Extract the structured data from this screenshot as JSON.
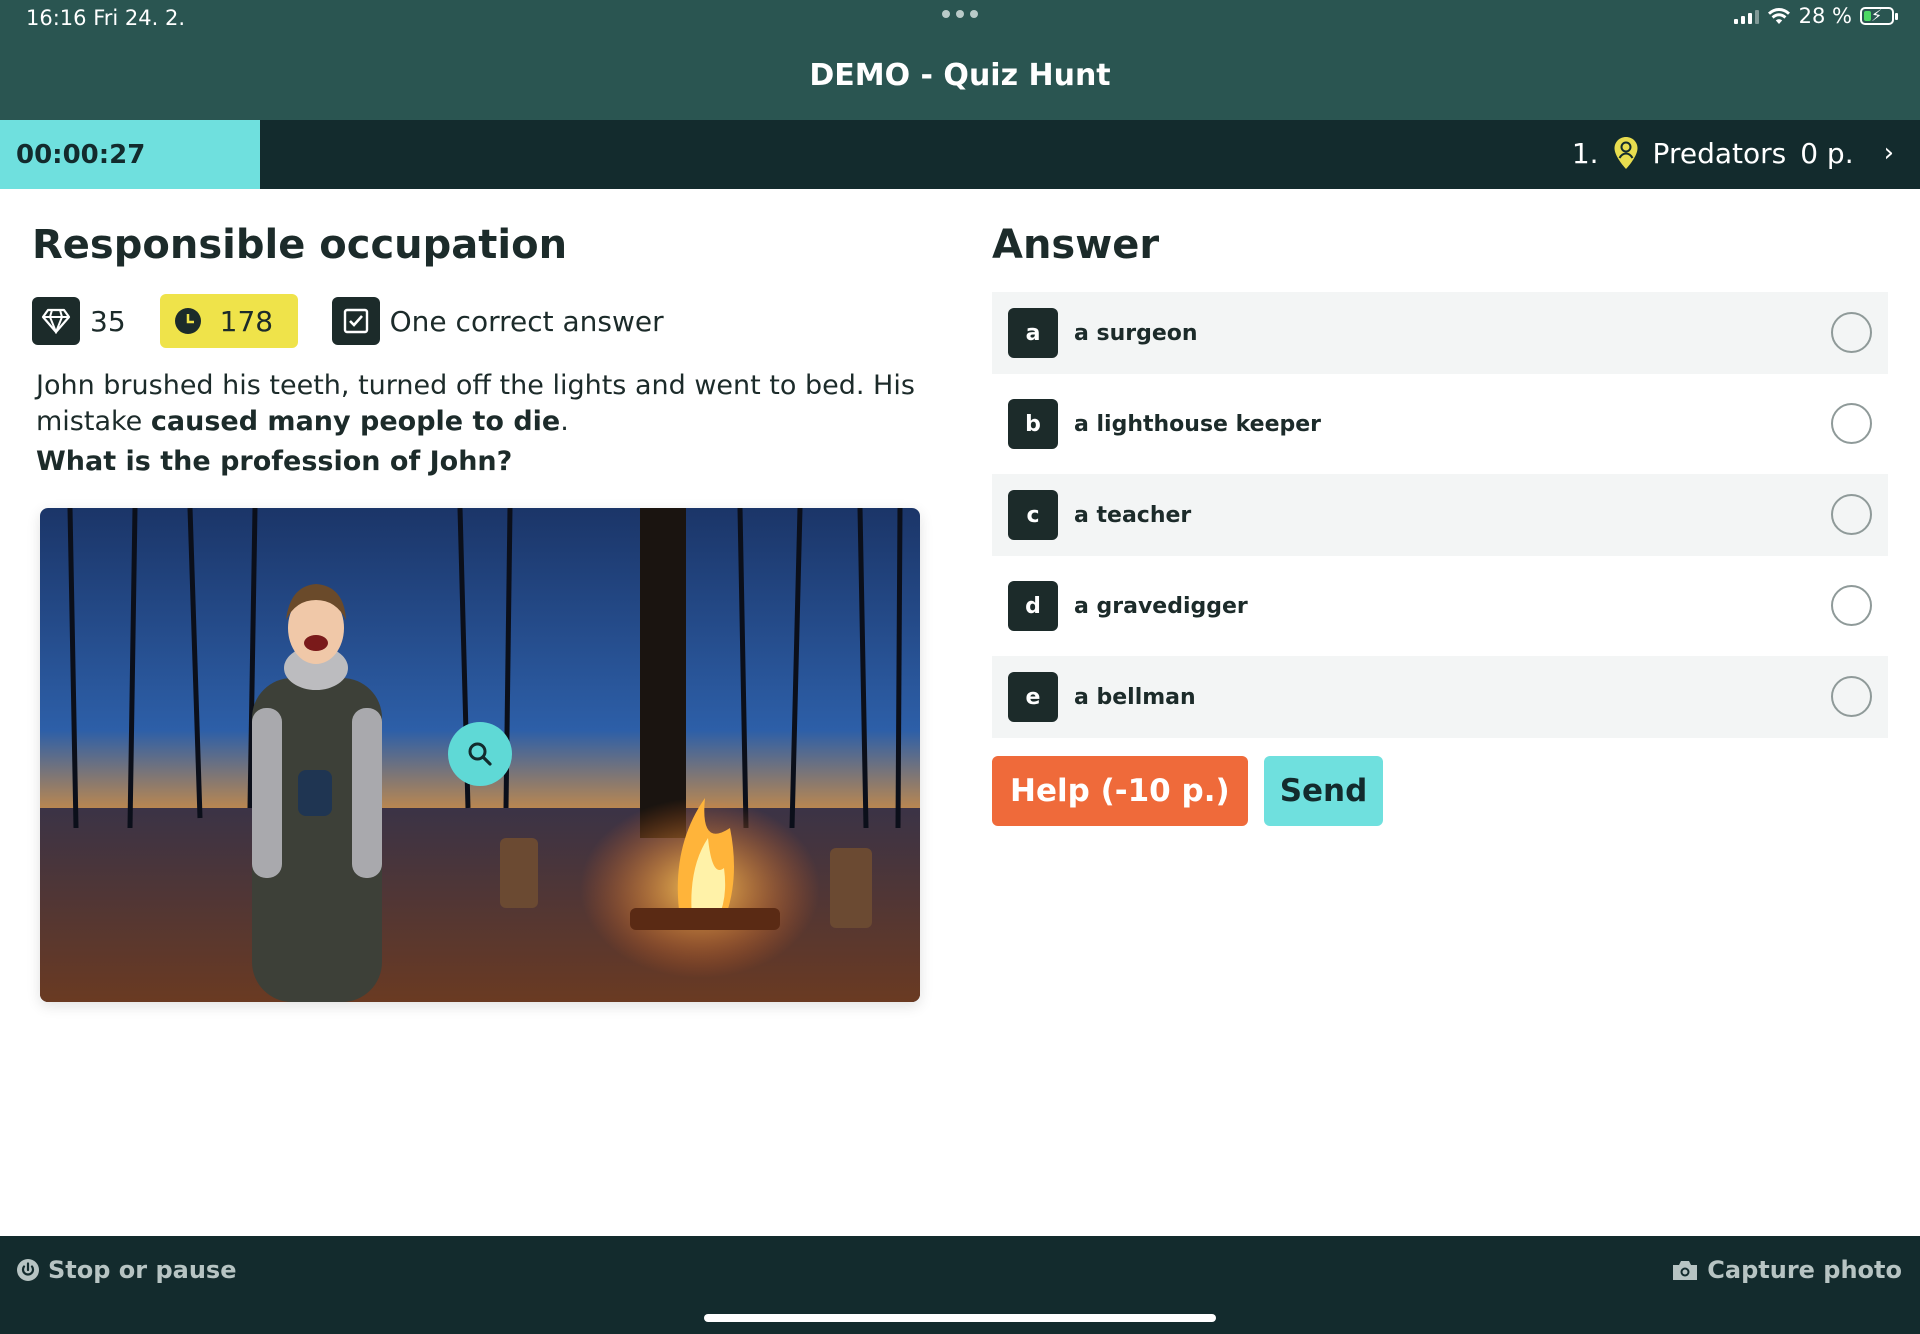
{
  "status_bar": {
    "time_date": "16:16   Fri 24. 2.",
    "battery": "28 %",
    "battery_level": 0.28
  },
  "app": {
    "title": "DEMO - Quiz Hunt"
  },
  "infobar": {
    "timer": "00:00:27",
    "team_rank": "1.",
    "team_name": "Predators",
    "team_points": "0 p."
  },
  "question": {
    "title": "Responsible occupation",
    "points": "35",
    "time_limit": "178",
    "answer_type": "One correct answer",
    "text_part1": "John brushed his teeth, turned off the lights and went to bed. His mistake ",
    "text_bold": "caused many people to die",
    "text_part2": ".",
    "question": "What is the profession of John?"
  },
  "answers": {
    "heading": "Answer",
    "options": [
      {
        "letter": "a",
        "label": "a surgeon"
      },
      {
        "letter": "b",
        "label": "a lighthouse keeper"
      },
      {
        "letter": "c",
        "label": "a teacher"
      },
      {
        "letter": "d",
        "label": "a gravedigger"
      },
      {
        "letter": "e",
        "label": "a bellman"
      }
    ],
    "help_button": "Help (-10 p.)",
    "send_button": "Send"
  },
  "footer": {
    "stop_label": "Stop or pause",
    "capture_label": "Capture photo"
  },
  "colors": {
    "header_bg": "#2a5551",
    "infobar_bg": "#132b2d",
    "accent_cyan": "#6fe0de",
    "time_yellow": "#efe34a",
    "help_orange": "#ef6a3a",
    "dark": "#1c2b2a"
  },
  "icons": [
    "diamond-icon",
    "clock-icon",
    "checkbox-icon",
    "location-pin-icon",
    "chevron-right-icon",
    "search-icon",
    "power-icon",
    "camera-icon"
  ]
}
